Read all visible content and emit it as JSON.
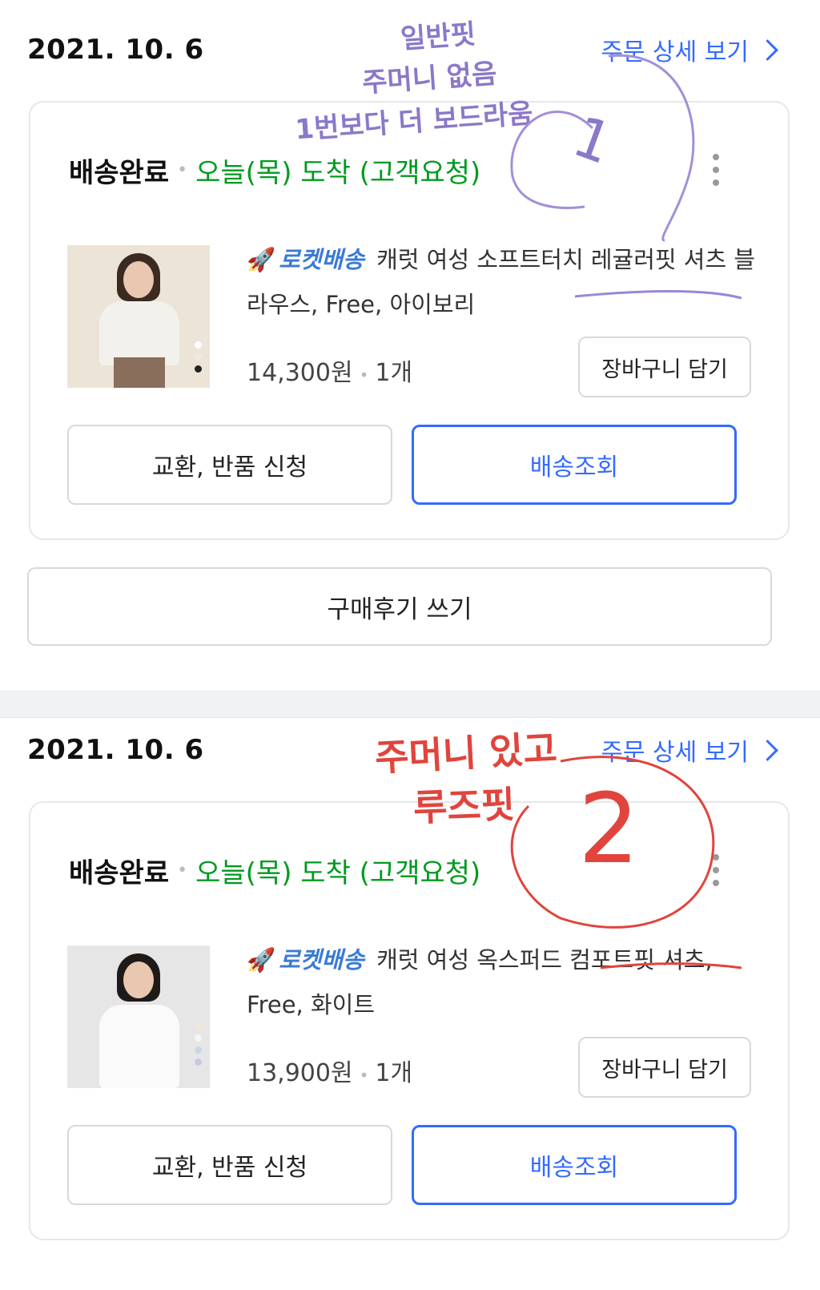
{
  "orders": [
    {
      "date": "2021. 10. 6",
      "detail_link": "주문 상세 보기",
      "status": "배송완료",
      "arrival": "오늘(목) 도착 (고객요청)",
      "rocket_label": "로켓배송",
      "product_name": "캐럿 여성 소프트터치 레귤러핏 셔츠 블라우스, Free, 아이보리",
      "price": "14,300원",
      "quantity": "1개",
      "cart_button": "장바구니 담기",
      "exchange_button": "교환, 반품 신청",
      "tracking_button": "배송조회",
      "review_button": "구매후기 쓰기",
      "thumbnail_swatches": [
        "#ffffff",
        "#f0ebe1",
        "#222222"
      ],
      "handwritten_note": [
        "일반핏",
        "주머니 없음",
        "1번보다 더 보드라움"
      ],
      "handwritten_number": "1"
    },
    {
      "date": "2021. 10. 6",
      "detail_link": "주문 상세 보기",
      "status": "배송완료",
      "arrival": "오늘(목) 도착 (고객요청)",
      "rocket_label": "로켓배송",
      "product_name": "캐럿 여성 옥스퍼드 컴포트핏 셔츠, Free, 화이트",
      "price": "13,900원",
      "quantity": "1개",
      "cart_button": "장바구니 담기",
      "exchange_button": "교환, 반품 신청",
      "tracking_button": "배송조회",
      "thumbnail_swatches": [
        "#efe7d8",
        "#f5f5f5",
        "#c9d6ea",
        "#c7c7e6"
      ],
      "handwritten_note": [
        "주머니 있고",
        "루즈핏"
      ],
      "handwritten_number": "2"
    }
  ],
  "colors": {
    "accent_blue": "#346aff",
    "arrival_green": "#009a1f",
    "rocket_blue": "#3a7bd5",
    "note_purple": "#8b78c9",
    "note_red": "#e0443c"
  },
  "icons": {
    "detail_chevron": "chevron-right-icon",
    "more_menu": "kebab-menu-icon",
    "rocket": "rocket-icon"
  }
}
